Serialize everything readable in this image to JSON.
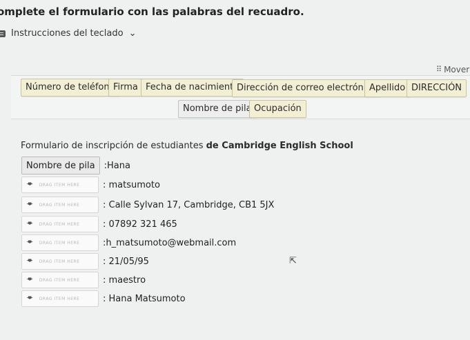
{
  "page": {
    "title": "omplete el formulario con las palabras del recuadro.",
    "keyboard_instructions": "Instrucciones del teclado",
    "move_label": "Mover"
  },
  "word_bank": {
    "chips": [
      "Número de teléfono",
      "Firma",
      "Fecha de nacimiento",
      "Dirección de correo electrónico",
      "Apellido",
      "DIRECCIÓN",
      "Nombre de pila",
      "Ocupación"
    ]
  },
  "form": {
    "instruction_plain": "Formulario de inscripción de estudiantes ",
    "instruction_bold": "de Cambridge English School",
    "drop_placeholder": "DRAG ITEM HERE",
    "rows": [
      {
        "label": "Nombre de pila",
        "value": ":Hana"
      },
      {
        "label": "",
        "value": ": matsumoto"
      },
      {
        "label": "",
        "value": ": Calle Sylvan 17, Cambridge, CB1 5JX"
      },
      {
        "label": "",
        "value": ": 07892 321 465"
      },
      {
        "label": "",
        "value": ":h_matsumoto@webmail.com"
      },
      {
        "label": "",
        "value": ": 21/05/95"
      },
      {
        "label": "",
        "value": ": maestro"
      },
      {
        "label": "",
        "value": ": Hana Matsumoto"
      }
    ]
  },
  "icons": {
    "keyboard": "keyboard-icon",
    "chevron": "chevron-down-icon",
    "grip": "grip-icon",
    "arrow": "arrow-down-icon",
    "cursor": "mouse-cursor-icon"
  },
  "colors": {
    "chip_fill": "#f3efd5",
    "placed_chip_fill": "#eaeaea",
    "background": "#eef1f0"
  }
}
